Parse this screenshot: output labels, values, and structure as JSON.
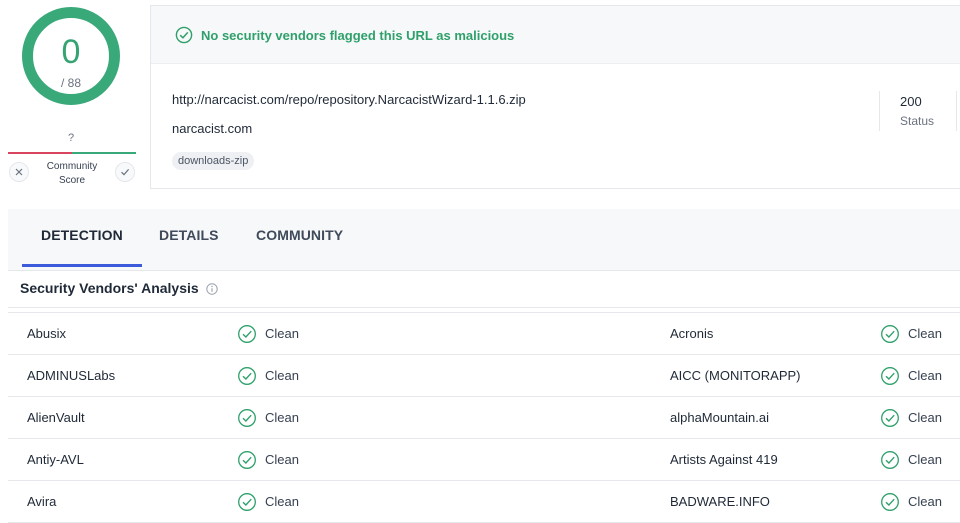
{
  "score": {
    "detections": "0",
    "total": "/ 88",
    "community_unknown": "?",
    "community_label_line1": "Community",
    "community_label_line2": "Score"
  },
  "summary": {
    "message": "No security vendors flagged this URL as malicious",
    "url": "http://narcacist.com/repo/repository.NarcacistWizard-1.1.6.zip",
    "domain": "narcacist.com",
    "tag": "downloads-zip",
    "status_code": "200",
    "status_label": "Status"
  },
  "tabs": [
    {
      "label": "DETECTION",
      "active": true
    },
    {
      "label": "DETAILS",
      "active": false
    },
    {
      "label": "COMMUNITY",
      "active": false
    }
  ],
  "analysis": {
    "title": "Security Vendors' Analysis",
    "rows": [
      {
        "left_vendor": "Abusix",
        "left_result": "Clean",
        "right_vendor": "Acronis",
        "right_result": "Clean"
      },
      {
        "left_vendor": "ADMINUSLabs",
        "left_result": "Clean",
        "right_vendor": "AICC (MONITORAPP)",
        "right_result": "Clean"
      },
      {
        "left_vendor": "AlienVault",
        "left_result": "Clean",
        "right_vendor": "alphaMountain.ai",
        "right_result": "Clean"
      },
      {
        "left_vendor": "Antiy-AVL",
        "left_result": "Clean",
        "right_vendor": "Artists Against 419",
        "right_result": "Clean"
      },
      {
        "left_vendor": "Avira",
        "left_result": "Clean",
        "right_vendor": "BADWARE.INFO",
        "right_result": "Clean"
      }
    ]
  },
  "colors": {
    "clean_green": "#2fa06b",
    "ring_green": "#3aa97a",
    "malicious_red": "#d9455f",
    "tab_accent": "#3b5bdb"
  },
  "icons": {
    "banner": "check-circle-icon",
    "vote_down": "close-icon",
    "vote_up": "check-icon",
    "info": "info-icon",
    "result": "check-circle-icon"
  }
}
